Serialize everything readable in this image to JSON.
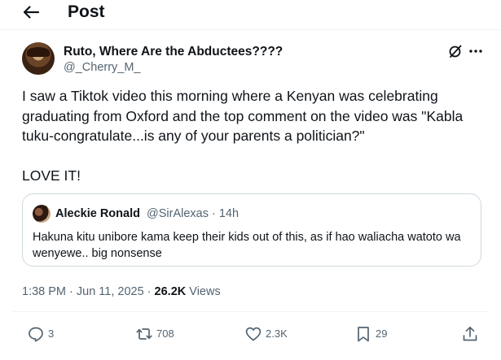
{
  "header": {
    "title": "Post",
    "back_icon": "arrow-left-icon"
  },
  "author": {
    "name": "Ruto, Where Are the Abductees????",
    "handle": "@_Cherry_M_"
  },
  "post": {
    "text": "I saw a Tiktok video this morning where a Kenyan was celebrating graduating from Oxford and the top comment on the video was \"Kabla tuku-congratulate...is  any of your parents a politician?\"\n\nLOVE IT!"
  },
  "quote": {
    "name": "Aleckie Ronald",
    "meta": "@SirAlexas · 14h",
    "text": "Hakuna kitu unibore kama keep their kids out of this, as if hao waliacha watoto wa wenyewe.. big nonsense"
  },
  "meta": {
    "timestamp": "1:38 PM · Jun 11, 2025 · ",
    "views_count": "26.2K",
    "views_label": " Views"
  },
  "actions": {
    "reply": "3",
    "repost": "708",
    "like": "2.3K",
    "bookmark": "29"
  },
  "colors": {
    "text": "#0f1419",
    "secondary": "#536471",
    "border": "#cfd9de"
  }
}
